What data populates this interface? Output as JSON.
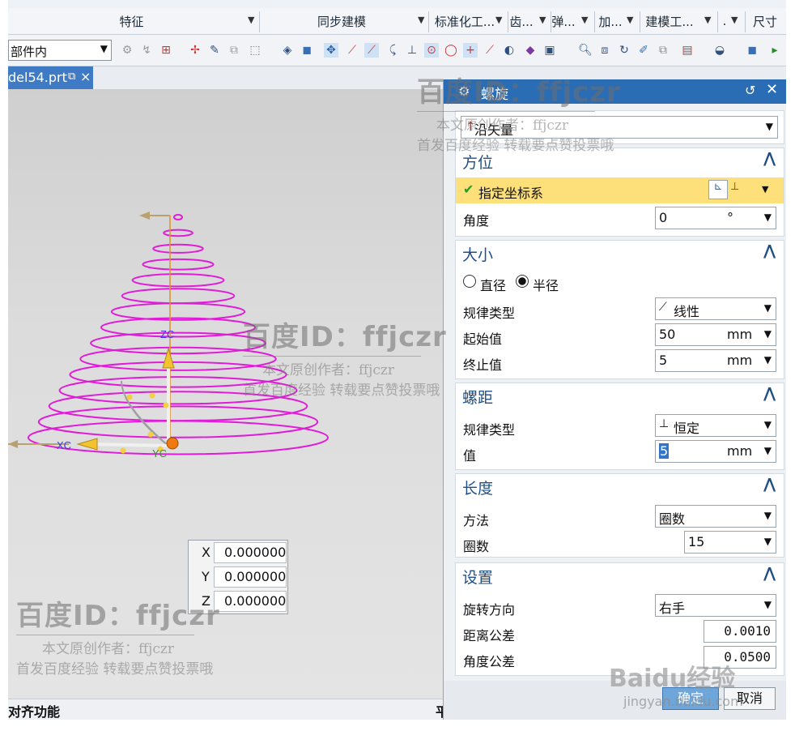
{
  "ribbon": {
    "groups": [
      "特征",
      "同步建模",
      "标准化工...",
      "齿...",
      "弹...",
      "加...",
      "建模工...",
      ".",
      "尺寸"
    ]
  },
  "toolbar": {
    "scope_select": "部件内"
  },
  "tab": {
    "label": "del54.prt",
    "close_glyph": "×"
  },
  "viewport": {
    "axis_labels": {
      "zc": "ZC",
      "xc": "XC",
      "yc": "YC"
    },
    "coords": [
      {
        "label": "X",
        "value": "0.000000"
      },
      {
        "label": "Y",
        "value": "0.000000"
      },
      {
        "label": "Z",
        "value": "0.000000"
      }
    ],
    "helix_color": "#e01cd8",
    "helix_turns": 15
  },
  "status": {
    "left": "对齐功能",
    "right": "平"
  },
  "dialog": {
    "title": "螺旋",
    "type_value": "沿矢量",
    "orientation": {
      "title": "方位",
      "specify_csys": "指定坐标系",
      "angle_label": "角度",
      "angle_value": "0",
      "angle_unit": "°"
    },
    "size": {
      "title": "大小",
      "diameter": "直径",
      "radius": "半径",
      "law_label": "规律类型",
      "law_value": "线性",
      "start_label": "起始值",
      "start_value": "50",
      "end_label": "终止值",
      "end_value": "5",
      "unit": "mm"
    },
    "pitch": {
      "title": "螺距",
      "law_label": "规律类型",
      "law_value": "恒定",
      "value_label": "值",
      "value": "5",
      "unit": "mm"
    },
    "length": {
      "title": "长度",
      "method_label": "方法",
      "method_value": "圈数",
      "turns_label": "圈数",
      "turns_value": "15"
    },
    "settings": {
      "title": "设置",
      "direction_label": "旋转方向",
      "direction_value": "右手",
      "dist_tol_label": "距离公差",
      "dist_tol_value": "0.0010",
      "angle_tol_label": "角度公差",
      "angle_tol_value": "0.0500"
    },
    "ok": "确定",
    "cancel": "取消"
  },
  "watermark": {
    "id": "百度ID：ffjczr",
    "author": "本文原创作者：ffjczr",
    "note": "首发百度经验 转载要点赞投票哦",
    "logo": "Baidu经验",
    "site": "jingyan.baidu.com"
  },
  "colors": {
    "accent": "#2a6db5",
    "highlight_row": "#fde07a",
    "helix": "#e01cd8"
  }
}
